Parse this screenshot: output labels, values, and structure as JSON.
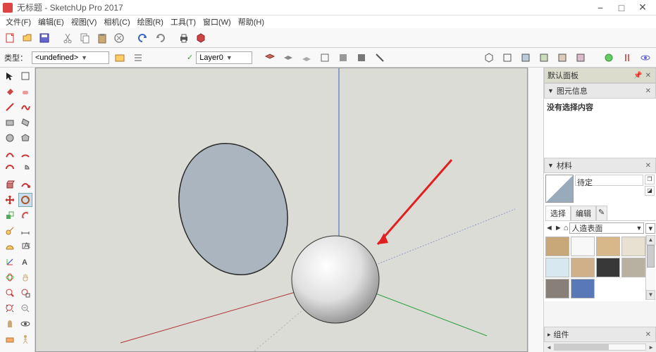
{
  "window": {
    "title": "无标题 - SketchUp Pro 2017",
    "min": "−",
    "max": "□",
    "close": "✕"
  },
  "menu": {
    "file": "文件(F)",
    "edit": "编辑(E)",
    "view": "视图(V)",
    "camera": "相机(C)",
    "draw": "绘图(R)",
    "tools": "工具(T)",
    "window": "窗口(W)",
    "help": "帮助(H)"
  },
  "toolbar2": {
    "type_label": "类型：",
    "type_value": "<undefined>",
    "layer_value": "Layer0"
  },
  "trays": {
    "default_panel": "默认面板",
    "entity_info": "图元信息",
    "no_selection": "没有选择内容",
    "materials": "材料",
    "mat_name": "待定",
    "select_tab": "选择",
    "edit_tab": "编辑",
    "collection": "人造表面",
    "components": "组件"
  },
  "glyph": {
    "tri_down": "▼",
    "tri_right": "▸",
    "check": "✓",
    "pin": "📌",
    "x": "✕",
    "up": "▲",
    "dn": "▼",
    "home": "⌂",
    "menu": "▾",
    "pencil": "✎"
  }
}
